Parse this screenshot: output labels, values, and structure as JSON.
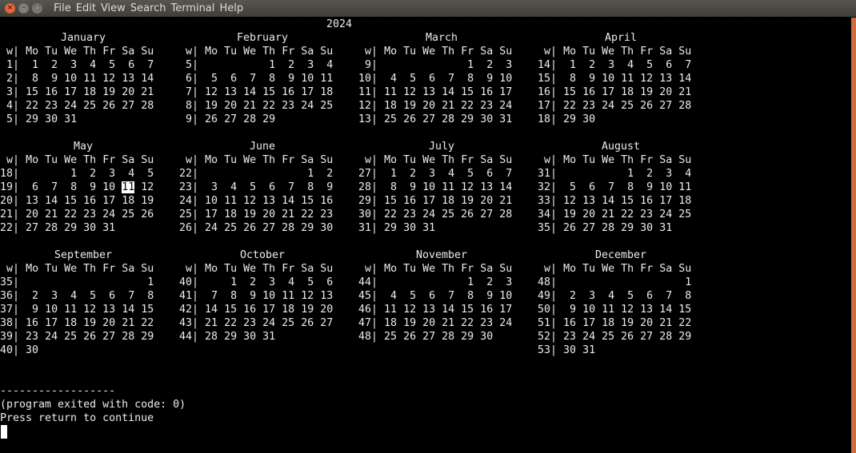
{
  "window": {
    "buttons": [
      "close",
      "minimize",
      "maximize"
    ],
    "menu": [
      "File",
      "Edit",
      "View",
      "Search",
      "Terminal",
      "Help"
    ]
  },
  "colors": {
    "scrollbar": "#d4693f",
    "text": "#ececec",
    "background": "#000000"
  },
  "calendar": {
    "year": "2024",
    "week_label": "w",
    "weekdays": [
      "Mo",
      "Tu",
      "We",
      "Th",
      "Fr",
      "Sa",
      "Su"
    ],
    "today": {
      "month": "May",
      "day": "11"
    },
    "months": [
      {
        "name": "January",
        "weeks": [
          {
            "w": "1",
            "d": [
              "1",
              "2",
              "3",
              "4",
              "5",
              "6",
              "7"
            ]
          },
          {
            "w": "2",
            "d": [
              "8",
              "9",
              "10",
              "11",
              "12",
              "13",
              "14"
            ]
          },
          {
            "w": "3",
            "d": [
              "15",
              "16",
              "17",
              "18",
              "19",
              "20",
              "21"
            ]
          },
          {
            "w": "4",
            "d": [
              "22",
              "23",
              "24",
              "25",
              "26",
              "27",
              "28"
            ]
          },
          {
            "w": "5",
            "d": [
              "29",
              "30",
              "31"
            ]
          }
        ]
      },
      {
        "name": "February",
        "weeks": [
          {
            "w": "5",
            "d": [
              "",
              "",
              "",
              "1",
              "2",
              "3",
              "4"
            ]
          },
          {
            "w": "6",
            "d": [
              "5",
              "6",
              "7",
              "8",
              "9",
              "10",
              "11"
            ]
          },
          {
            "w": "7",
            "d": [
              "12",
              "13",
              "14",
              "15",
              "16",
              "17",
              "18"
            ]
          },
          {
            "w": "8",
            "d": [
              "19",
              "20",
              "21",
              "22",
              "23",
              "24",
              "25"
            ]
          },
          {
            "w": "9",
            "d": [
              "26",
              "27",
              "28",
              "29"
            ]
          }
        ]
      },
      {
        "name": "March",
        "weeks": [
          {
            "w": "9",
            "d": [
              "",
              "",
              "",
              "",
              "1",
              "2",
              "3"
            ]
          },
          {
            "w": "10",
            "d": [
              "4",
              "5",
              "6",
              "7",
              "8",
              "9",
              "10"
            ]
          },
          {
            "w": "11",
            "d": [
              "11",
              "12",
              "13",
              "14",
              "15",
              "16",
              "17"
            ]
          },
          {
            "w": "12",
            "d": [
              "18",
              "19",
              "20",
              "21",
              "22",
              "23",
              "24"
            ]
          },
          {
            "w": "13",
            "d": [
              "25",
              "26",
              "27",
              "28",
              "29",
              "30",
              "31"
            ]
          }
        ]
      },
      {
        "name": "April",
        "weeks": [
          {
            "w": "14",
            "d": [
              "1",
              "2",
              "3",
              "4",
              "5",
              "6",
              "7"
            ]
          },
          {
            "w": "15",
            "d": [
              "8",
              "9",
              "10",
              "11",
              "12",
              "13",
              "14"
            ]
          },
          {
            "w": "16",
            "d": [
              "15",
              "16",
              "17",
              "18",
              "19",
              "20",
              "21"
            ]
          },
          {
            "w": "17",
            "d": [
              "22",
              "23",
              "24",
              "25",
              "26",
              "27",
              "28"
            ]
          },
          {
            "w": "18",
            "d": [
              "29",
              "30"
            ]
          }
        ]
      },
      {
        "name": "May",
        "weeks": [
          {
            "w": "18",
            "d": [
              "",
              "",
              "1",
              "2",
              "3",
              "4",
              "5"
            ]
          },
          {
            "w": "19",
            "d": [
              "6",
              "7",
              "8",
              "9",
              "10",
              "11",
              "12"
            ]
          },
          {
            "w": "20",
            "d": [
              "13",
              "14",
              "15",
              "16",
              "17",
              "18",
              "19"
            ]
          },
          {
            "w": "21",
            "d": [
              "20",
              "21",
              "22",
              "23",
              "24",
              "25",
              "26"
            ]
          },
          {
            "w": "22",
            "d": [
              "27",
              "28",
              "29",
              "30",
              "31"
            ]
          }
        ]
      },
      {
        "name": "June",
        "weeks": [
          {
            "w": "22",
            "d": [
              "",
              "",
              "",
              "",
              "",
              "1",
              "2"
            ]
          },
          {
            "w": "23",
            "d": [
              "3",
              "4",
              "5",
              "6",
              "7",
              "8",
              "9"
            ]
          },
          {
            "w": "24",
            "d": [
              "10",
              "11",
              "12",
              "13",
              "14",
              "15",
              "16"
            ]
          },
          {
            "w": "25",
            "d": [
              "17",
              "18",
              "19",
              "20",
              "21",
              "22",
              "23"
            ]
          },
          {
            "w": "26",
            "d": [
              "24",
              "25",
              "26",
              "27",
              "28",
              "29",
              "30"
            ]
          }
        ]
      },
      {
        "name": "July",
        "weeks": [
          {
            "w": "27",
            "d": [
              "1",
              "2",
              "3",
              "4",
              "5",
              "6",
              "7"
            ]
          },
          {
            "w": "28",
            "d": [
              "8",
              "9",
              "10",
              "11",
              "12",
              "13",
              "14"
            ]
          },
          {
            "w": "29",
            "d": [
              "15",
              "16",
              "17",
              "18",
              "19",
              "20",
              "21"
            ]
          },
          {
            "w": "30",
            "d": [
              "22",
              "23",
              "24",
              "25",
              "26",
              "27",
              "28"
            ]
          },
          {
            "w": "31",
            "d": [
              "29",
              "30",
              "31"
            ]
          }
        ]
      },
      {
        "name": "August",
        "weeks": [
          {
            "w": "31",
            "d": [
              "",
              "",
              "",
              "1",
              "2",
              "3",
              "4"
            ]
          },
          {
            "w": "32",
            "d": [
              "5",
              "6",
              "7",
              "8",
              "9",
              "10",
              "11"
            ]
          },
          {
            "w": "33",
            "d": [
              "12",
              "13",
              "14",
              "15",
              "16",
              "17",
              "18"
            ]
          },
          {
            "w": "34",
            "d": [
              "19",
              "20",
              "21",
              "22",
              "23",
              "24",
              "25"
            ]
          },
          {
            "w": "35",
            "d": [
              "26",
              "27",
              "28",
              "29",
              "30",
              "31"
            ]
          }
        ]
      },
      {
        "name": "September",
        "weeks": [
          {
            "w": "35",
            "d": [
              "",
              "",
              "",
              "",
              "",
              "",
              "1"
            ]
          },
          {
            "w": "36",
            "d": [
              "2",
              "3",
              "4",
              "5",
              "6",
              "7",
              "8"
            ]
          },
          {
            "w": "37",
            "d": [
              "9",
              "10",
              "11",
              "12",
              "13",
              "14",
              "15"
            ]
          },
          {
            "w": "38",
            "d": [
              "16",
              "17",
              "18",
              "19",
              "20",
              "21",
              "22"
            ]
          },
          {
            "w": "39",
            "d": [
              "23",
              "24",
              "25",
              "26",
              "27",
              "28",
              "29"
            ]
          },
          {
            "w": "40",
            "d": [
              "30"
            ]
          }
        ]
      },
      {
        "name": "October",
        "weeks": [
          {
            "w": "40",
            "d": [
              "",
              "1",
              "2",
              "3",
              "4",
              "5",
              "6"
            ]
          },
          {
            "w": "41",
            "d": [
              "7",
              "8",
              "9",
              "10",
              "11",
              "12",
              "13"
            ]
          },
          {
            "w": "42",
            "d": [
              "14",
              "15",
              "16",
              "17",
              "18",
              "19",
              "20"
            ]
          },
          {
            "w": "43",
            "d": [
              "21",
              "22",
              "23",
              "24",
              "25",
              "26",
              "27"
            ]
          },
          {
            "w": "44",
            "d": [
              "28",
              "29",
              "30",
              "31"
            ]
          }
        ]
      },
      {
        "name": "November",
        "weeks": [
          {
            "w": "44",
            "d": [
              "",
              "",
              "",
              "",
              "1",
              "2",
              "3"
            ]
          },
          {
            "w": "45",
            "d": [
              "4",
              "5",
              "6",
              "7",
              "8",
              "9",
              "10"
            ]
          },
          {
            "w": "46",
            "d": [
              "11",
              "12",
              "13",
              "14",
              "15",
              "16",
              "17"
            ]
          },
          {
            "w": "47",
            "d": [
              "18",
              "19",
              "20",
              "21",
              "22",
              "23",
              "24"
            ]
          },
          {
            "w": "48",
            "d": [
              "25",
              "26",
              "27",
              "28",
              "29",
              "30"
            ]
          }
        ]
      },
      {
        "name": "December",
        "weeks": [
          {
            "w": "48",
            "d": [
              "",
              "",
              "",
              "",
              "",
              "",
              "1"
            ]
          },
          {
            "w": "49",
            "d": [
              "2",
              "3",
              "4",
              "5",
              "6",
              "7",
              "8"
            ]
          },
          {
            "w": "50",
            "d": [
              "9",
              "10",
              "11",
              "12",
              "13",
              "14",
              "15"
            ]
          },
          {
            "w": "51",
            "d": [
              "16",
              "17",
              "18",
              "19",
              "20",
              "21",
              "22"
            ]
          },
          {
            "w": "52",
            "d": [
              "23",
              "24",
              "25",
              "26",
              "27",
              "28",
              "29"
            ]
          },
          {
            "w": "53",
            "d": [
              "30",
              "31"
            ]
          }
        ]
      }
    ]
  },
  "footer": {
    "separator": "------------------",
    "exit_message": "(program exited with code: 0)",
    "prompt": "Press return to continue"
  }
}
